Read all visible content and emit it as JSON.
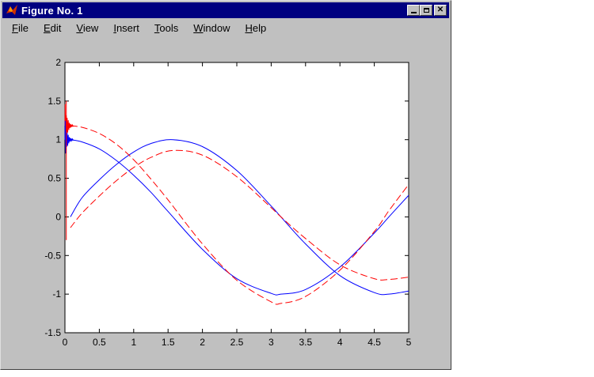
{
  "window": {
    "title": "Figure No. 1",
    "icon": "matlab-icon",
    "controls": [
      "minimize",
      "maximize",
      "close"
    ]
  },
  "menu": {
    "items": [
      {
        "label": "File",
        "underline": "F",
        "rest": "ile"
      },
      {
        "label": "Edit",
        "underline": "E",
        "rest": "dit"
      },
      {
        "label": "View",
        "underline": "V",
        "rest": "iew"
      },
      {
        "label": "Insert",
        "underline": "I",
        "rest": "nsert"
      },
      {
        "label": "Tools",
        "underline": "T",
        "rest": "ools"
      },
      {
        "label": "Window",
        "underline": "W",
        "rest": "indow"
      },
      {
        "label": "Help",
        "underline": "H",
        "rest": "elp"
      }
    ]
  },
  "chart_data": {
    "type": "line",
    "title": "",
    "xlabel": "",
    "ylabel": "",
    "xlim": [
      0,
      5
    ],
    "ylim": [
      -1.5,
      2
    ],
    "xticks": [
      "0",
      "0.5",
      "1",
      "1.5",
      "2",
      "2.5",
      "3",
      "3.5",
      "4",
      "4.5",
      "5"
    ],
    "yticks": [
      "2",
      "1.5",
      "1",
      "0.5",
      "0",
      "-0.5",
      "-1",
      "-1.5"
    ],
    "grid": false,
    "series": [
      {
        "color": "#0000ff",
        "style": "solid",
        "x": [
          0.08,
          0.25,
          0.5,
          0.75,
          1.0,
          1.25,
          1.5708,
          2.0,
          2.5,
          3.0,
          3.1416,
          3.5,
          4.0,
          4.5,
          4.7124,
          5.0
        ],
        "y": [
          0.0,
          0.25,
          0.48,
          0.68,
          0.84,
          0.95,
          1.0,
          0.91,
          0.6,
          0.14,
          0.0,
          -0.35,
          -0.76,
          -0.98,
          -1.0,
          -0.96
        ]
      },
      {
        "color": "#0000ff",
        "style": "solid",
        "x": [
          0.08,
          0.25,
          0.5,
          0.75,
          1.0,
          1.25,
          1.5,
          2.0,
          2.5,
          3.0,
          3.1416,
          3.5,
          4.0,
          4.5,
          4.7124,
          5.0
        ],
        "y": [
          1.0,
          0.97,
          0.88,
          0.73,
          0.54,
          0.32,
          0.07,
          -0.42,
          -0.8,
          -0.99,
          -1.0,
          -0.94,
          -0.65,
          -0.21,
          0.0,
          0.28
        ]
      },
      {
        "color": "#ff0000",
        "style": "dashed",
        "x": [
          0.08,
          0.25,
          0.5,
          0.75,
          1.0,
          1.25,
          1.5708,
          2.0,
          2.5,
          3.0,
          3.1416,
          3.5,
          4.0,
          4.5,
          4.7124,
          5.0
        ],
        "y": [
          -0.14,
          0.05,
          0.27,
          0.47,
          0.64,
          0.77,
          0.86,
          0.8,
          0.52,
          0.12,
          0.0,
          -0.28,
          -0.62,
          -0.8,
          -0.81,
          -0.78
        ]
      },
      {
        "color": "#ff0000",
        "style": "dashed",
        "x": [
          0.08,
          0.25,
          0.5,
          0.75,
          1.0,
          1.25,
          1.5,
          2.0,
          2.5,
          3.0,
          3.1416,
          3.5,
          4.0,
          4.5,
          4.7124,
          5.0
        ],
        "y": [
          1.18,
          1.16,
          1.08,
          0.94,
          0.74,
          0.49,
          0.22,
          -0.35,
          -0.82,
          -1.1,
          -1.12,
          -1.03,
          -0.69,
          -0.19,
          0.08,
          0.42
        ]
      }
    ]
  }
}
